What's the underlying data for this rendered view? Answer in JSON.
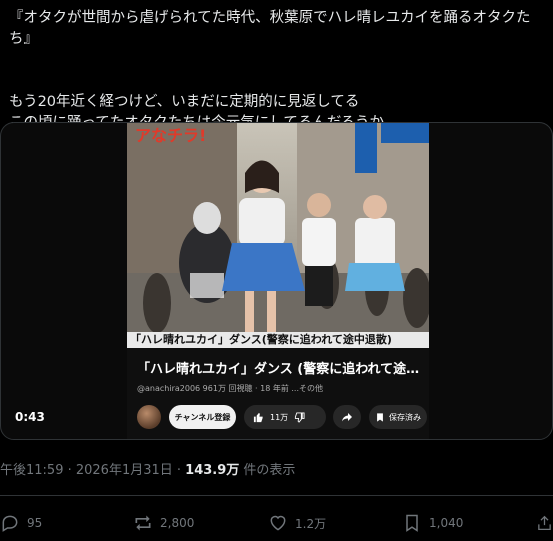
{
  "post": {
    "text_line1": "『オタクが世間から虐げられてた時代、秋葉原でハレ晴レユカイを踊るオタクたち』",
    "text_line2": "もう20年近く経つけど、いまだに定期的に見返してる",
    "text_line3": "この頃に踊ってたオタクたちは今元気にしてるんだろうか……",
    "timestamp": "午後11:59 · 2026年1月31日 · ",
    "views": "143.9万",
    "views_suffix": " 件の表示"
  },
  "video": {
    "overlay_text": "アなチラ!",
    "caption": "「ハレ晴れユカイ」ダンス(警察に追われて途中退散)",
    "title": "「ハレ晴れユカイ」ダンス (警察に追われて途…",
    "channel": "@anachira2006",
    "meta": "961万 回視聴 · 18 年前  ...その他",
    "subscribe_label": "チャンネル登録",
    "like_count": "11万",
    "save_label": "保存済み",
    "time": "0:43"
  },
  "actions": {
    "replies": "95",
    "reposts": "2,800",
    "likes": "1.2万",
    "bookmarks": "1,040"
  },
  "icons": [
    "reply-icon",
    "repost-icon",
    "like-icon",
    "bookmark-icon",
    "share-icon",
    "thumbs-up-icon",
    "thumbs-down-icon",
    "youtube-share-icon",
    "youtube-save-icon"
  ],
  "colors": {
    "background": "#000000",
    "text": "#e7e9ea",
    "muted": "#71767b",
    "border": "#2f3336"
  }
}
